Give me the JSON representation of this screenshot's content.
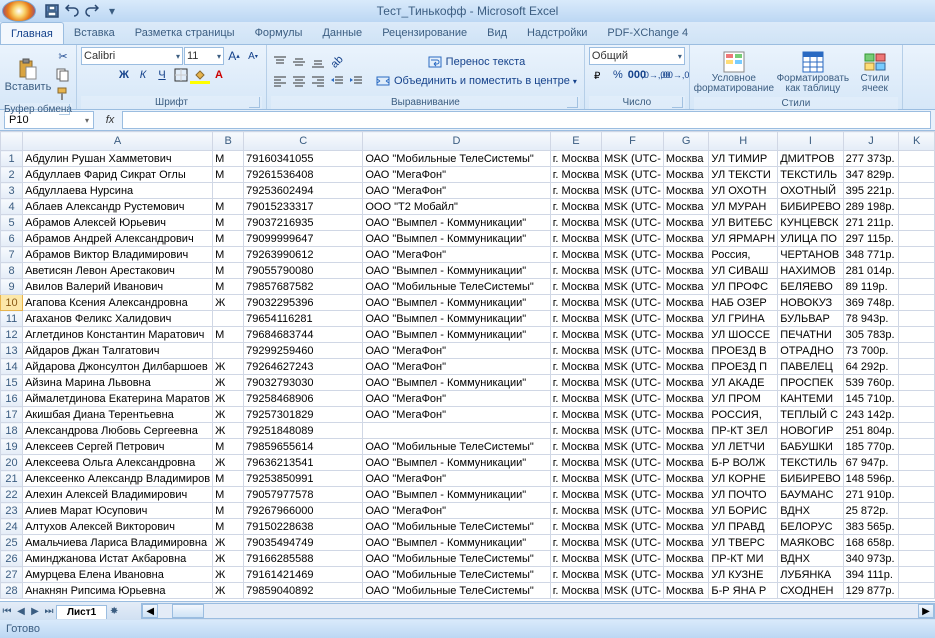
{
  "titlebar": {
    "title": "Тест_Тинькофф - Microsoft Excel"
  },
  "tabs": [
    "Главная",
    "Вставка",
    "Разметка страницы",
    "Формулы",
    "Данные",
    "Рецензирование",
    "Вид",
    "Надстройки",
    "PDF-XChange 4"
  ],
  "active_tab": 0,
  "ribbon": {
    "clipboard": {
      "title": "Буфер обмена",
      "paste": "Вставить"
    },
    "font": {
      "title": "Шрифт",
      "name": "Calibri",
      "size": "11"
    },
    "alignment": {
      "title": "Выравнивание",
      "wrap": "Перенос текста",
      "merge": "Объединить и поместить в центре"
    },
    "number": {
      "title": "Число",
      "format": "Общий"
    },
    "styles": {
      "title": "Стили",
      "cond": "Условное форматирование",
      "table": "Форматировать как таблицу",
      "cell": "Стили ячеек"
    }
  },
  "formula": {
    "name_box": "P10",
    "fx": "fx"
  },
  "sheet": {
    "columns": [
      "A",
      "B",
      "C",
      "D",
      "E",
      "F",
      "G",
      "H",
      "I",
      "J",
      "K"
    ],
    "selected_row": 10,
    "rows": [
      [
        "Абдулин Рушан Хамметович",
        "М",
        "79160341055",
        "ОАО \"Мобильные ТелеСистемы\"",
        "г. Москва",
        "MSK (UTC-",
        "Москва",
        "УЛ ТИМИР",
        "ДМИТРОВ",
        "277 373р."
      ],
      [
        "Абдуллаев Фарид Сикрат Оглы",
        "М",
        "79261536408",
        "ОАО \"МегаФон\"",
        "г. Москва",
        "MSK (UTC-",
        "Москва",
        "УЛ ТЕКСТИ",
        "ТЕКСТИЛЬ",
        "347 829р."
      ],
      [
        "Абдуллаева Нурсина",
        "",
        "79253602494",
        "ОАО \"МегаФон\"",
        "г. Москва",
        "MSK (UTC-",
        "Москва",
        "УЛ ОХОТН",
        "ОХОТНЫЙ",
        "395 221р."
      ],
      [
        "Аблаев Александр Рустемович",
        "М",
        "79015233317",
        "ООО \"Т2 Мобайл\"",
        "г. Москва",
        "MSK (UTC-",
        "Москва",
        "УЛ МУРАН",
        "БИБИРЕВО",
        "289 198р."
      ],
      [
        "Абрамов Алексей Юрьевич",
        "М",
        "79037216935",
        "ОАО \"Вымпел - Коммуникации\"",
        "г. Москва",
        "MSK (UTC-",
        "Москва",
        "УЛ ВИТЕБС",
        "КУНЦЕВСК",
        "271 211р."
      ],
      [
        "Абрамов Андрей Александрович",
        "М",
        "79099999647",
        "ОАО \"Вымпел - Коммуникации\"",
        "г. Москва",
        "MSK (UTC-",
        "Москва",
        "УЛ ЯРМАРН",
        "УЛИЦА ПО",
        "297 115р."
      ],
      [
        "Абрамов Виктор Владимирович",
        "М",
        "79263990612",
        "ОАО \"МегаФон\"",
        "г. Москва",
        "MSK (UTC-",
        "Москва",
        "Россия,",
        "ЧЕРТАНОВ",
        "348 771р."
      ],
      [
        "Аветисян Левон Арестакович",
        "М",
        "79055790080",
        "ОАО \"Вымпел - Коммуникации\"",
        "г. Москва",
        "MSK (UTC-",
        "Москва",
        "УЛ СИВАШ",
        "НАХИМОВ",
        "281 014р."
      ],
      [
        "Авилов Валерий Иванович",
        "М",
        "79857687582",
        "ОАО \"Мобильные ТелеСистемы\"",
        "г. Москва",
        "MSK (UTC-",
        "Москва",
        "УЛ ПРОФС",
        "БЕЛЯЕВО",
        "89 119р."
      ],
      [
        "Агапова Ксения Александровна",
        "Ж",
        "79032295396",
        "ОАО \"Вымпел - Коммуникации\"",
        "г. Москва",
        "MSK (UTC-",
        "Москва",
        "НАБ ОЗЕР",
        "НОВОКУЗ",
        "369 748р."
      ],
      [
        "Агаханов Феликс Халидович",
        "",
        "79654116281",
        "ОАО \"Вымпел - Коммуникации\"",
        "г. Москва",
        "MSK (UTC-",
        "Москва",
        "УЛ ГРИНА",
        "БУЛЬВАР",
        "78 943р."
      ],
      [
        "Аглетдинов Константин Маратович",
        "М",
        "79684683744",
        "ОАО \"Вымпел - Коммуникации\"",
        "г. Москва",
        "MSK (UTC-",
        "Москва",
        "УЛ ШОССЕ",
        "ПЕЧАТНИ",
        "305 783р."
      ],
      [
        "Айдаров Джан Талгатович",
        "",
        "79299259460",
        "ОАО \"МегаФон\"",
        "г. Москва",
        "MSK (UTC-",
        "Москва",
        "ПРОЕЗД В",
        "ОТРАДНО",
        "73 700р."
      ],
      [
        "Айдарова Джонсултон Дилбаршоев",
        "Ж",
        "79264627243",
        "ОАО \"МегаФон\"",
        "г. Москва",
        "MSK (UTC-",
        "Москва",
        "ПРОЕЗД П",
        "ПАВЕЛЕЦ",
        "64 292р."
      ],
      [
        "Айзина Марина Львовна",
        "Ж",
        "79032793030",
        "ОАО \"Вымпел - Коммуникации\"",
        "г. Москва",
        "MSK (UTC-",
        "Москва",
        "УЛ АКАДЕ",
        "ПРОСПЕК",
        "539 760р."
      ],
      [
        "Аймалетдинова Екатерина Маратов",
        "Ж",
        "79258468906",
        "ОАО \"МегаФон\"",
        "г. Москва",
        "MSK (UTC-",
        "Москва",
        "УЛ ПРОМ",
        "КАНТЕМИ",
        "145 710р."
      ],
      [
        "Акишбая Диана Терентьевна",
        "Ж",
        "79257301829",
        "ОАО \"МегаФон\"",
        "г. Москва",
        "MSK (UTC-",
        "Москва",
        "РОССИЯ,",
        "ТЕПЛЫЙ С",
        "243 142р."
      ],
      [
        "Александрова Любовь Сергеевна",
        "Ж",
        "79251848089",
        "",
        "г. Москва",
        "MSK (UTC-",
        "Москва",
        "ПР-КТ ЗЕЛ",
        "НОВОГИР",
        "251 804р."
      ],
      [
        "Алексеев Сергей Петрович",
        "М",
        "79859655614",
        "ОАО \"Мобильные ТелеСистемы\"",
        "г. Москва",
        "MSK (UTC-",
        "Москва",
        "УЛ ЛЕТЧИ",
        "БАБУШКИ",
        "185 770р."
      ],
      [
        "Алексеева Ольга Александровна",
        "Ж",
        "79636213541",
        "ОАО \"Вымпел - Коммуникации\"",
        "г. Москва",
        "MSK (UTC-",
        "Москва",
        "Б-Р ВОЛЖ",
        "ТЕКСТИЛЬ",
        "67 947р."
      ],
      [
        "Алексеенко Александр Владимиров",
        "М",
        "79253850991",
        "ОАО \"МегаФон\"",
        "г. Москва",
        "MSK (UTC-",
        "Москва",
        "УЛ КОРНЕ",
        "БИБИРЕВО",
        "148 596р."
      ],
      [
        "Алехин Алексей Владимирович",
        "М",
        "79057977578",
        "ОАО \"Вымпел - Коммуникации\"",
        "г. Москва",
        "MSK (UTC-",
        "Москва",
        "УЛ ПОЧТО",
        "БАУМАНС",
        "271 910р."
      ],
      [
        "Алиев Марат Юсупович",
        "М",
        "79267966000",
        "ОАО \"МегаФон\"",
        "г. Москва",
        "MSK (UTC-",
        "Москва",
        "УЛ БОРИС",
        "ВДНХ",
        "25 872р."
      ],
      [
        "Алтухов Алексей Викторович",
        "М",
        "79150228638",
        "ОАО \"Мобильные ТелеСистемы\"",
        "г. Москва",
        "MSK (UTC-",
        "Москва",
        "УЛ ПРАВД",
        "БЕЛОРУС",
        "383 565р."
      ],
      [
        "Амальчиева Лариса Владимировна",
        "Ж",
        "79035494749",
        "ОАО \"Вымпел - Коммуникации\"",
        "г. Москва",
        "MSK (UTC-",
        "Москва",
        "УЛ ТВЕРС",
        "МАЯКОВС",
        "168 658р."
      ],
      [
        "Аминджанова Истат Акбаровна",
        "Ж",
        "79166285588",
        "ОАО \"Мобильные ТелеСистемы\"",
        "г. Москва",
        "MSK (UTC-",
        "Москва",
        "ПР-КТ МИ",
        "ВДНХ",
        "340 973р."
      ],
      [
        "Амурцева Елена Ивановна",
        "Ж",
        "79161421469",
        "ОАО \"Мобильные ТелеСистемы\"",
        "г. Москва",
        "MSK (UTC-",
        "Москва",
        "УЛ КУЗНЕ",
        "ЛУБЯНКА",
        "394 111р."
      ],
      [
        "Анакнян Рипсима Юрьевна",
        "Ж",
        "79859040892",
        "ОАО \"Мобильные ТелеСистемы\"",
        "г. Москва",
        "MSK (UTC-",
        "Москва",
        "Б-Р ЯНА Р",
        "СХОДНЕН",
        "129 877р."
      ]
    ]
  },
  "sheet_tabs": {
    "active": "Лист1"
  },
  "status": {
    "ready": "Готово"
  }
}
